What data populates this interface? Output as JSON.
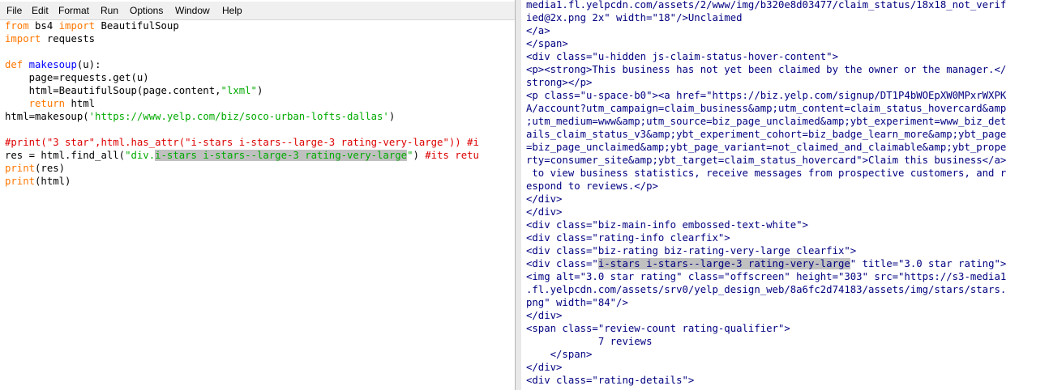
{
  "editor": {
    "menu": [
      "File",
      "Edit",
      "Format",
      "Run",
      "Options",
      "Window",
      "Help"
    ],
    "code_lines": [
      [
        {
          "t": "from",
          "c": "kw"
        },
        {
          "t": " bs4 "
        },
        {
          "t": "import",
          "c": "kw"
        },
        {
          "t": " BeautifulSoup"
        }
      ],
      [
        {
          "t": "import",
          "c": "kw"
        },
        {
          "t": " requests"
        }
      ],
      [],
      [
        {
          "t": "def",
          "c": "kw"
        },
        {
          "t": " "
        },
        {
          "t": "makesoup",
          "c": "def"
        },
        {
          "t": "(u):"
        }
      ],
      [
        {
          "t": "    page=requests.get(u)"
        }
      ],
      [
        {
          "t": "    html=BeautifulSoup(page.content,"
        },
        {
          "t": "\"lxml\"",
          "c": "str"
        },
        {
          "t": ")"
        }
      ],
      [
        {
          "t": "    "
        },
        {
          "t": "return",
          "c": "kw"
        },
        {
          "t": " html"
        }
      ],
      [
        {
          "t": "html=makesoup("
        },
        {
          "t": "'https://www.yelp.com/biz/soco-urban-lofts-dallas'",
          "c": "str"
        },
        {
          "t": ")"
        }
      ],
      [],
      [
        {
          "t": "#print(\"3 star\",html.has_attr(\"i-stars i-stars--large-3 rating-very-large\")) #i",
          "c": "cmt"
        }
      ],
      [
        {
          "t": "res = html.find_all("
        },
        {
          "t": "\"div.",
          "c": "str"
        },
        {
          "t": "i-stars i-stars--large-3 rating-very-large",
          "c": "str hl"
        },
        {
          "t": "\"",
          "c": "str"
        },
        {
          "t": ") "
        },
        {
          "t": "#its retu",
          "c": "cmt"
        }
      ],
      [
        {
          "t": "print",
          "c": "kw"
        },
        {
          "t": "(res)"
        }
      ],
      [
        {
          "t": "print",
          "c": "kw"
        },
        {
          "t": "(html)"
        }
      ]
    ]
  },
  "source": {
    "lines": [
      [
        {
          "t": "media1.fl.yelpcdn.com/assets/2/www/img/b320e8d03477/claim_status/18x18_not_verif"
        }
      ],
      [
        {
          "t": "ied@2x.png 2x\" width=\"18\"/>Unclaimed"
        }
      ],
      [
        {
          "t": "</a>"
        }
      ],
      [
        {
          "t": "</span>"
        }
      ],
      [
        {
          "t": "<div class=\"u-hidden js-claim-status-hover-content\">"
        }
      ],
      [
        {
          "t": "<p><strong>This business has not yet been claimed by the owner or the manager.</"
        }
      ],
      [
        {
          "t": "strong></p>"
        }
      ],
      [
        {
          "t": "<p class=\"u-space-b0\"><a href=\"https://biz.yelp.com/signup/DT1P4bWOEpXW0MPxrWXPK"
        }
      ],
      [
        {
          "t": "A/account?utm_campaign=claim_business&amp;utm_content=claim_status_hovercard&amp"
        }
      ],
      [
        {
          "t": ";utm_medium=www&amp;utm_source=biz_page_unclaimed&amp;ybt_experiment=www_biz_det"
        }
      ],
      [
        {
          "t": "ails_claim_status_v3&amp;ybt_experiment_cohort=biz_badge_learn_more&amp;ybt_page"
        }
      ],
      [
        {
          "t": "=biz_page_unclaimed&amp;ybt_page_variant=not_claimed_and_claimable&amp;ybt_prope"
        }
      ],
      [
        {
          "t": "rty=consumer_site&amp;ybt_target=claim_status_hovercard\">Claim this business</a>"
        }
      ],
      [
        {
          "t": " to view business statistics, receive messages from prospective customers, and r"
        }
      ],
      [
        {
          "t": "espond to reviews.</p>"
        }
      ],
      [
        {
          "t": "</div>"
        }
      ],
      [
        {
          "t": "</div>"
        }
      ],
      [
        {
          "t": "<div class=\"biz-main-info embossed-text-white\">"
        }
      ],
      [
        {
          "t": "<div class=\"rating-info clearfix\">"
        }
      ],
      [
        {
          "t": "<div class=\"biz-rating biz-rating-very-large clearfix\">"
        }
      ],
      [
        {
          "t": "<div class=\""
        },
        {
          "t": "i-stars i-stars--large-3 rating-very-large",
          "c": "hl"
        },
        {
          "t": "\" title=\"3.0 star rating\">"
        }
      ],
      [
        {
          "t": "<img alt=\"3.0 star rating\" class=\"offscreen\" height=\"303\" src=\"https://s3-media1"
        }
      ],
      [
        {
          "t": ".fl.yelpcdn.com/assets/srv0/yelp_design_web/8a6fc2d74183/assets/img/stars/stars."
        }
      ],
      [
        {
          "t": "png\" width=\"84\"/>"
        }
      ],
      [
        {
          "t": "</div>"
        }
      ],
      [
        {
          "t": "<span class=\"review-count rating-qualifier\">"
        }
      ],
      [
        {
          "t": "            7 reviews"
        }
      ],
      [
        {
          "t": "    </span>"
        }
      ],
      [
        {
          "t": "</div>"
        }
      ],
      [
        {
          "t": "<div class=\"rating-details\">"
        }
      ]
    ]
  }
}
